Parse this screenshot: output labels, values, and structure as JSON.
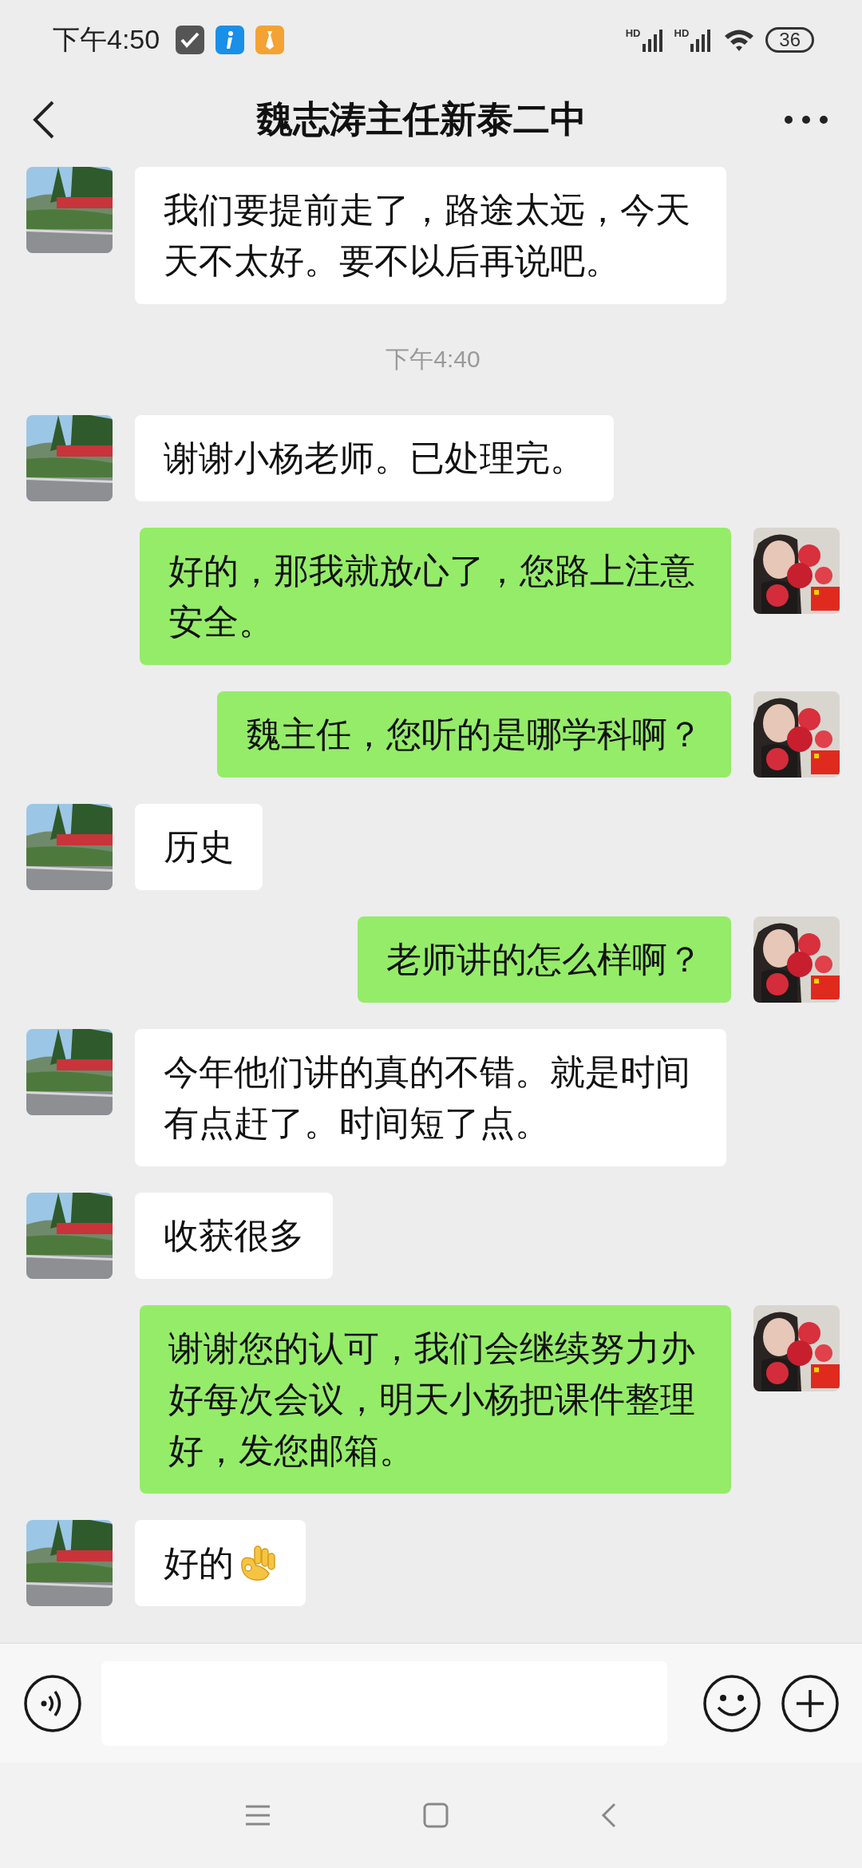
{
  "status_bar": {
    "time": "下午4:50",
    "signal_labels": [
      "HD",
      "HD"
    ],
    "battery": "36"
  },
  "header": {
    "title": "魏志涛主任新泰二中"
  },
  "messages": [
    {
      "kind": "incoming",
      "text": "我们要提前走了，路途太远，今天天不太好。要不以后再说吧。"
    },
    {
      "kind": "time",
      "text": "下午4:40"
    },
    {
      "kind": "incoming",
      "text": "谢谢小杨老师。已处理完。"
    },
    {
      "kind": "outgoing",
      "text": "好的，那我就放心了，您路上注意安全。"
    },
    {
      "kind": "outgoing",
      "text": "魏主任，您听的是哪学科啊？"
    },
    {
      "kind": "incoming",
      "text": "历史"
    },
    {
      "kind": "outgoing",
      "text": "老师讲的怎么样啊？"
    },
    {
      "kind": "incoming",
      "text": "今年他们讲的真的不错。就是时间有点赶了。时间短了点。"
    },
    {
      "kind": "incoming",
      "text": "收获很多"
    },
    {
      "kind": "outgoing",
      "text": "谢谢您的认可，我们会继续努力办好每次会议，明天小杨把课件整理好，发您邮箱。"
    },
    {
      "kind": "incoming",
      "text": "好的",
      "ok_hand": true
    }
  ]
}
